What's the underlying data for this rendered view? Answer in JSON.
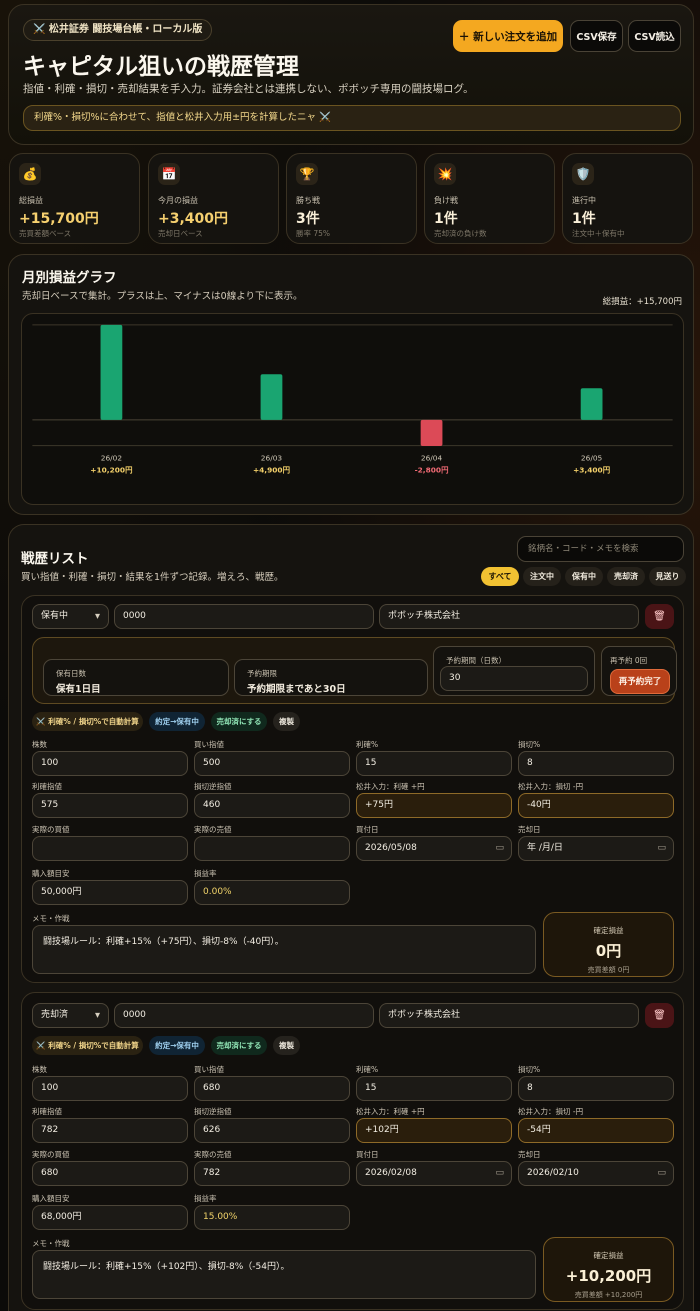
{
  "header": {
    "tag": "⚔️ 松井証券 闘技場台帳・ローカル版",
    "title": "キャピタル狙いの戦歴管理",
    "subtitle": "指値・利確・損切・売却結果を手入力。証券会社とは連携しない、ポボッチ専用の闘技場ログ。",
    "note": "利確%・損切%に合わせて、指値と松井入力用±円を計算したニャ ⚔️",
    "add_button": "＋ 新しい注文を追加",
    "csv_save": "CSV保存",
    "csv_import": "CSV読込"
  },
  "stats": [
    {
      "icon": "💰",
      "label": "総損益",
      "value": "+15,700円",
      "sub": "売買差額ベース"
    },
    {
      "icon": "📅",
      "label": "今月の損益",
      "value": "+3,400円",
      "sub": "売却日ベース"
    },
    {
      "icon": "🏆",
      "label": "勝ち戦",
      "value": "3件",
      "sub": "勝率 75%"
    },
    {
      "icon": "💥",
      "label": "負け戦",
      "value": "1件",
      "sub": "売却済の負け数"
    },
    {
      "icon": "🛡️",
      "label": "進行中",
      "value": "1件",
      "sub": "注文中＋保有中"
    }
  ],
  "chart": {
    "title": "月別損益グラフ",
    "subtitle": "売却日ベースで集計。プラスは上、マイナスは0線より下に表示。",
    "total": "総損益：+15,700円"
  },
  "chart_data": {
    "type": "bar",
    "categories": [
      "26/02",
      "26/03",
      "26/04",
      "26/05"
    ],
    "values": [
      10200,
      4900,
      -2800,
      3400
    ],
    "value_labels": [
      "+10,200円",
      "+4,900円",
      "-2,800円",
      "+3,400円"
    ],
    "ylim": [
      -3000,
      10200
    ],
    "colors": {
      "positive": "#1aa571",
      "negative": "#dc4a57"
    }
  },
  "list": {
    "title": "戦歴リスト",
    "subtitle": "買い指値・利確・損切・結果を1件ずつ記録。増えろ、戦歴。",
    "search_placeholder": "銘柄名・コード・メモを検索",
    "filters": [
      "すべて",
      "注文中",
      "保有中",
      "売却済",
      "見送り"
    ]
  },
  "labels": {
    "shares": "株数",
    "buy_limit": "買い指値",
    "profit_pct": "利確%",
    "loss_pct": "損切%",
    "profit_price": "利確指値",
    "loss_price": "損切逆指値",
    "matsui_profit": "松井入力：利確 +円",
    "matsui_loss": "松井入力：損切 -円",
    "actual_buy": "実際の買値",
    "actual_sell": "実際の売値",
    "buy_date": "買付日",
    "sell_date": "売却日",
    "purchase": "購入額目安",
    "pnl_rate": "損益率",
    "memo": "メモ・作戦",
    "confirmed_pnl": "確定損益"
  },
  "pills": [
    "⚔️ 利確% / 損切%で自動計算",
    "約定→保有中",
    "売却済にする",
    "複製"
  ],
  "trades": [
    {
      "status": "保有中",
      "code": "0000",
      "name": "ポボッチ株式会社",
      "hold_days_label": "保有日数",
      "hold_days": "保有1日目",
      "deadline_label": "予約期限",
      "deadline": "予約期限まであと30日",
      "period_label": "予約期間（日数）",
      "period": "30",
      "reorder_label": "再予約 0回",
      "reorder_button": "再予約完了",
      "shares": "100",
      "buy_limit": "500",
      "profit_pct": "15",
      "loss_pct": "8",
      "profit_price": "575",
      "loss_price": "460",
      "matsui_profit": "+75円",
      "matsui_loss": "-40円",
      "actual_buy": "",
      "actual_sell": "",
      "buy_date": "2026/05/08",
      "sell_date": "年 /月/日",
      "purchase": "50,000円",
      "pnl_rate": "0.00%",
      "memo": "闘技場ルール：利確+15%（+75円）、損切-8%（-40円）。",
      "pnl": "0円",
      "pnl_sub": "売買差額 0円"
    },
    {
      "status": "売却済",
      "code": "0000",
      "name": "ポボッチ株式会社",
      "shares": "100",
      "buy_limit": "680",
      "profit_pct": "15",
      "loss_pct": "8",
      "profit_price": "782",
      "loss_price": "626",
      "matsui_profit": "+102円",
      "matsui_loss": "-54円",
      "actual_buy": "680",
      "actual_sell": "782",
      "buy_date": "2026/02/08",
      "sell_date": "2026/02/10",
      "purchase": "68,000円",
      "pnl_rate": "15.00%",
      "memo": "闘技場ルール：利確+15%（+102円）、損切-8%（-54円）。",
      "pnl": "+10,200円",
      "pnl_sub": "売買差額 +10,200円"
    }
  ]
}
